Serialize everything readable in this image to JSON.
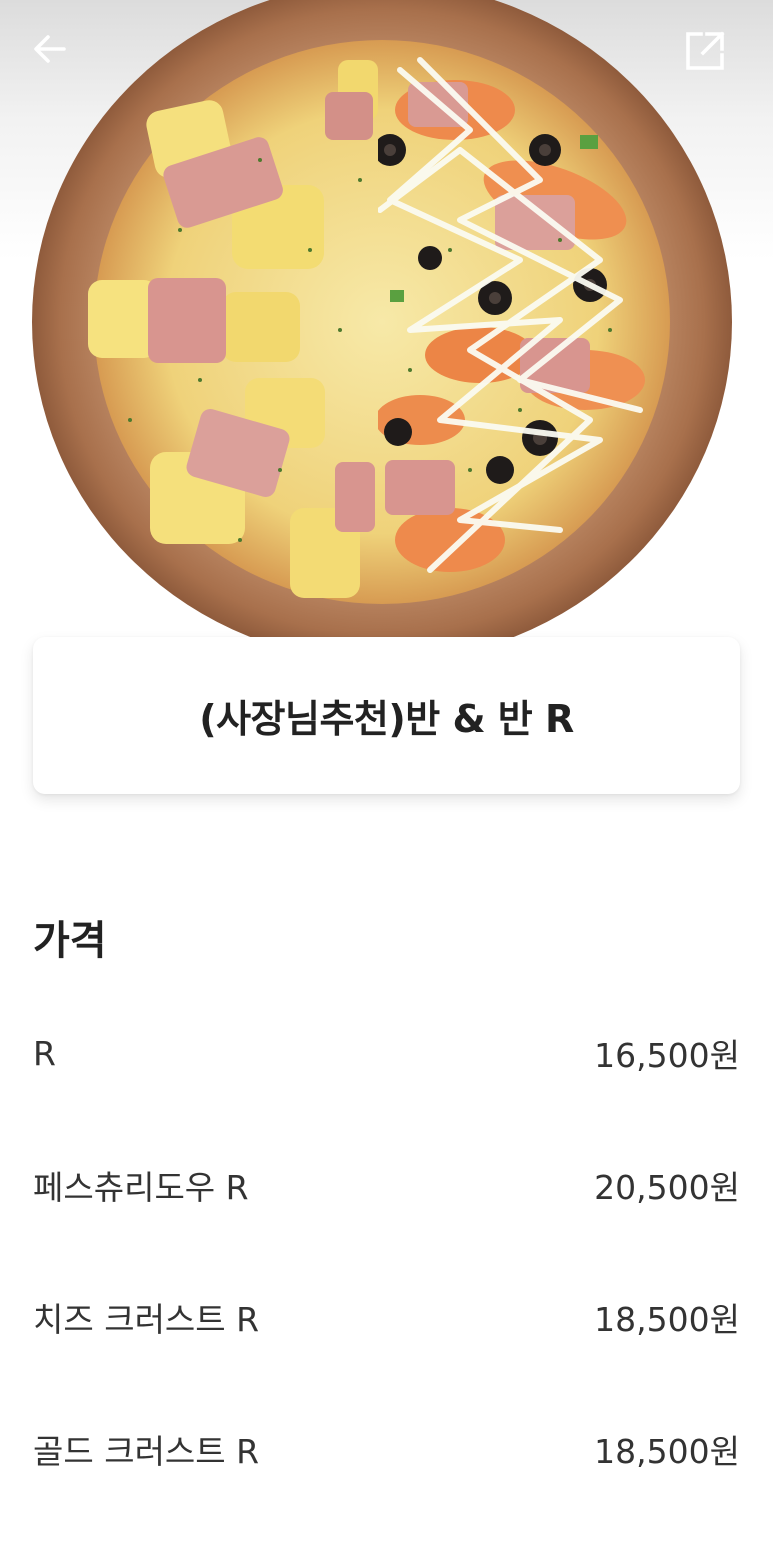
{
  "header": {
    "back_icon": "back-arrow-icon",
    "share_icon": "share-icon"
  },
  "product": {
    "title": "(사장님추천)반 & 반 R",
    "image": "pizza-photo"
  },
  "price_section": {
    "title": "가격",
    "items": [
      {
        "name": "R",
        "price": "16,500원"
      },
      {
        "name": "페스츄리도우 R",
        "price": "20,500원"
      },
      {
        "name": "치즈 크러스트 R",
        "price": "18,500원"
      },
      {
        "name": "골드 크러스트 R",
        "price": "18,500원"
      }
    ]
  },
  "colors": {
    "text": "#222222",
    "crust": "#b07a55",
    "cheese": "#f2dc86"
  }
}
